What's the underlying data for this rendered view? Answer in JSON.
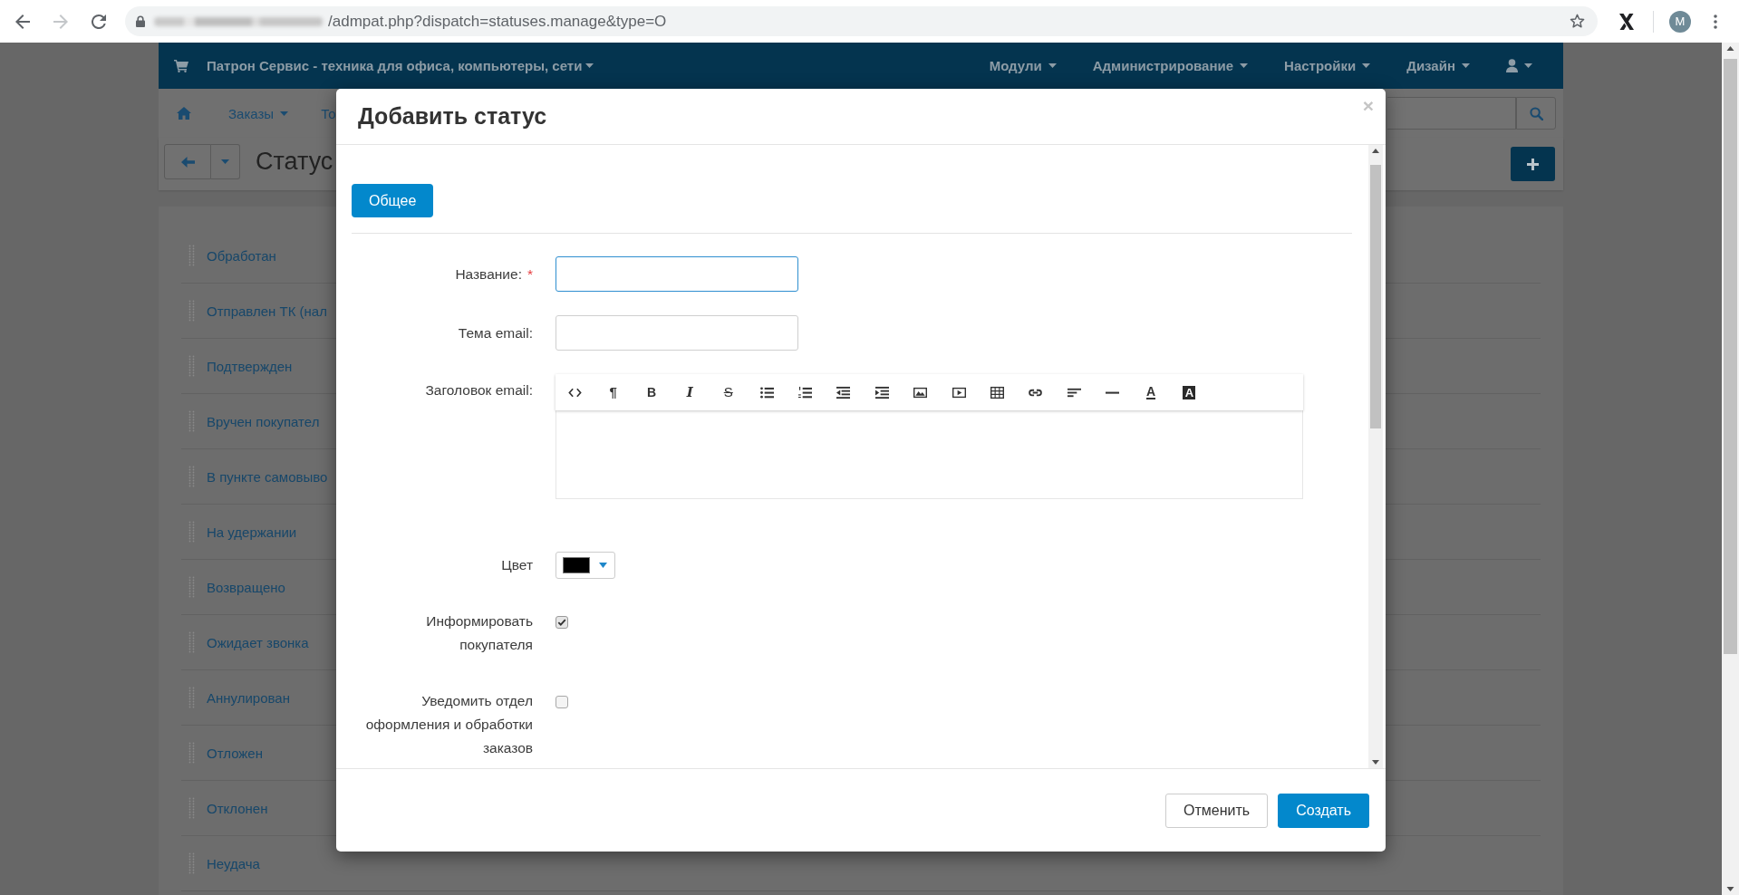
{
  "browser": {
    "url": "/admpat.php?dispatch=statuses.manage&type=O",
    "profile_initial": "M"
  },
  "top_nav": {
    "brand": "Патрон Сервис - техника для офиса, компьютеры, сети",
    "menus": [
      {
        "label": "Модули"
      },
      {
        "label": "Администрирование"
      },
      {
        "label": "Настройки"
      },
      {
        "label": "Дизайн"
      }
    ]
  },
  "sub_nav": {
    "items": [
      {
        "label": "Заказы",
        "dropdown": true
      },
      {
        "label": "То",
        "dropdown": false
      }
    ]
  },
  "page": {
    "title": "Статус"
  },
  "statuses": [
    {
      "name": "Обработан"
    },
    {
      "name": "Отправлен ТК (нал"
    },
    {
      "name": "Подтвержден"
    },
    {
      "name": "Вручен покупател"
    },
    {
      "name": "В пункте самовыво"
    },
    {
      "name": "На удержании"
    },
    {
      "name": "Возвращено"
    },
    {
      "name": "Ожидает звонка"
    },
    {
      "name": "Аннулирован"
    },
    {
      "name": "Отложен"
    },
    {
      "name": "Отклонен"
    },
    {
      "name": "Неудача"
    }
  ],
  "modal": {
    "title": "Добавить статус",
    "close": "×",
    "tabs": [
      {
        "label": "Общее",
        "selected": true
      }
    ],
    "fields": [
      {
        "kind": "text",
        "label": "Название:",
        "required_mark": "*",
        "focused": true
      },
      {
        "kind": "text",
        "label": "Тема email:",
        "focused": false
      },
      {
        "kind": "editor",
        "label": "Заголовок email:",
        "toolbar": [
          {
            "kind": "code"
          },
          {
            "kind": "paragraph",
            "glyph": "¶"
          },
          {
            "kind": "bold",
            "glyph": "B"
          },
          {
            "kind": "italic",
            "glyph": "I"
          },
          {
            "kind": "strike",
            "glyph": "S"
          },
          {
            "kind": "ul"
          },
          {
            "kind": "ol"
          },
          {
            "kind": "outdent"
          },
          {
            "kind": "indent"
          },
          {
            "kind": "image"
          },
          {
            "kind": "video"
          },
          {
            "kind": "table"
          },
          {
            "kind": "link"
          },
          {
            "kind": "align"
          },
          {
            "kind": "rule"
          },
          {
            "kind": "forecolor",
            "glyph": "A"
          },
          {
            "kind": "backcolor",
            "glyph": "A"
          }
        ]
      },
      {
        "kind": "color",
        "label": "Цвет",
        "color": "#000000"
      },
      {
        "kind": "checkbox",
        "label": "Информировать покупателя",
        "checked": true
      },
      {
        "kind": "checkbox",
        "label": "Уведомить отдел оформления и обработки заказов",
        "checked": false
      }
    ],
    "buttons": [
      {
        "label": "Отменить",
        "kind": "default"
      },
      {
        "label": "Создать",
        "kind": "primary"
      }
    ]
  }
}
